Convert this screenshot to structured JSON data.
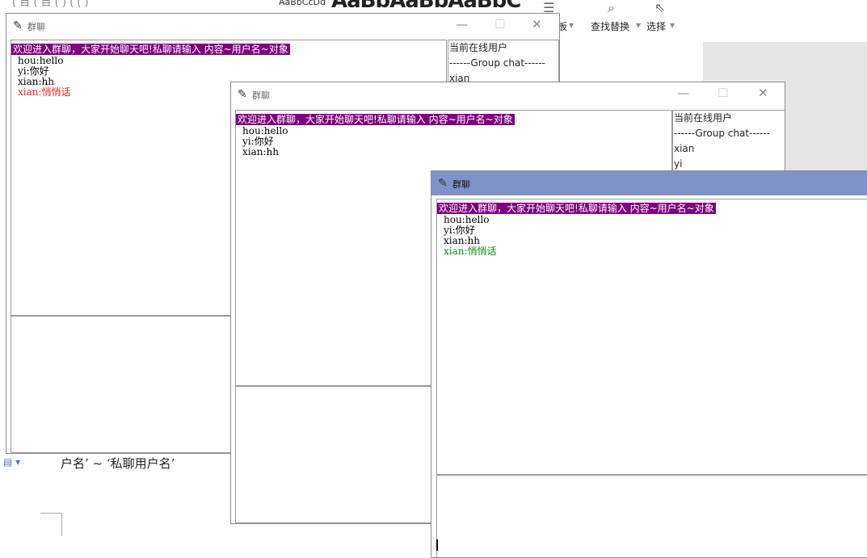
{
  "app": {
    "window_title": "群聊"
  },
  "background": {
    "menu_fragment": "( 目 ( 目 (  ) ( (  )",
    "style_sample_small": "AaBbCcDd",
    "style_sample_big": "AaBbAaBbAaBbC",
    "ribbon_items": [
      "板",
      "查找替换",
      "选择"
    ],
    "doc_text": "户名’ ~ ‘私聊用户名’"
  },
  "welcome_text": "欢迎进入群聊，大家开始聊天吧!私聊请输入 内容~用户名~对象",
  "user_list": {
    "header": "当前在线用户",
    "group_label": "------Group chat------"
  },
  "windows": [
    {
      "messages": [
        {
          "text": "hou:hello",
          "color": "#000000"
        },
        {
          "text": "yi:你好",
          "color": "#000000"
        },
        {
          "text": "xian:hh",
          "color": "#000000"
        },
        {
          "text": "xian:悄悄话",
          "color": "#e41c1c"
        }
      ],
      "online_users": [
        "xian"
      ]
    },
    {
      "messages": [
        {
          "text": "hou:hello",
          "color": "#000000"
        },
        {
          "text": "yi:你好",
          "color": "#000000"
        },
        {
          "text": "xian:hh",
          "color": "#000000"
        }
      ],
      "online_users": [
        "xian",
        "yi"
      ]
    },
    {
      "messages": [
        {
          "text": "hou:hello",
          "color": "#000000"
        },
        {
          "text": "yi:你好",
          "color": "#000000"
        },
        {
          "text": "xian:hh",
          "color": "#000000"
        },
        {
          "text": "xian:悄悄话",
          "color": "#0a8a0a"
        }
      ],
      "online_users": []
    }
  ],
  "colors": {
    "welcome_bg": "#800080",
    "active_titlebar": "#7f93c9",
    "private_red": "#e41c1c",
    "private_green": "#0a8a0a"
  }
}
